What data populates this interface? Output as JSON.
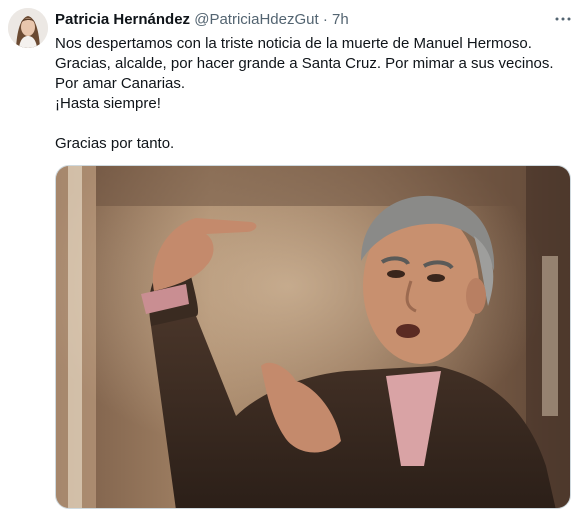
{
  "author": {
    "display_name": "Patricia Hernández",
    "handle": "@PatriciaHdezGut",
    "separator": "·",
    "time": "7h"
  },
  "more_icon": "more-horizontal-icon",
  "tweet": {
    "lines": [
      "Nos despertamos con la triste noticia de la muerte de Manuel Hermoso.",
      "Gracias, alcalde, por hacer grande a Santa Cruz. Por mimar a sus vecinos.",
      "Por amar Canarias.",
      "¡Hasta siempre!",
      "Gracias por tanto."
    ]
  },
  "colors": {
    "text": "#0f1419",
    "secondary": "#536471",
    "border": "#cfd9de"
  }
}
